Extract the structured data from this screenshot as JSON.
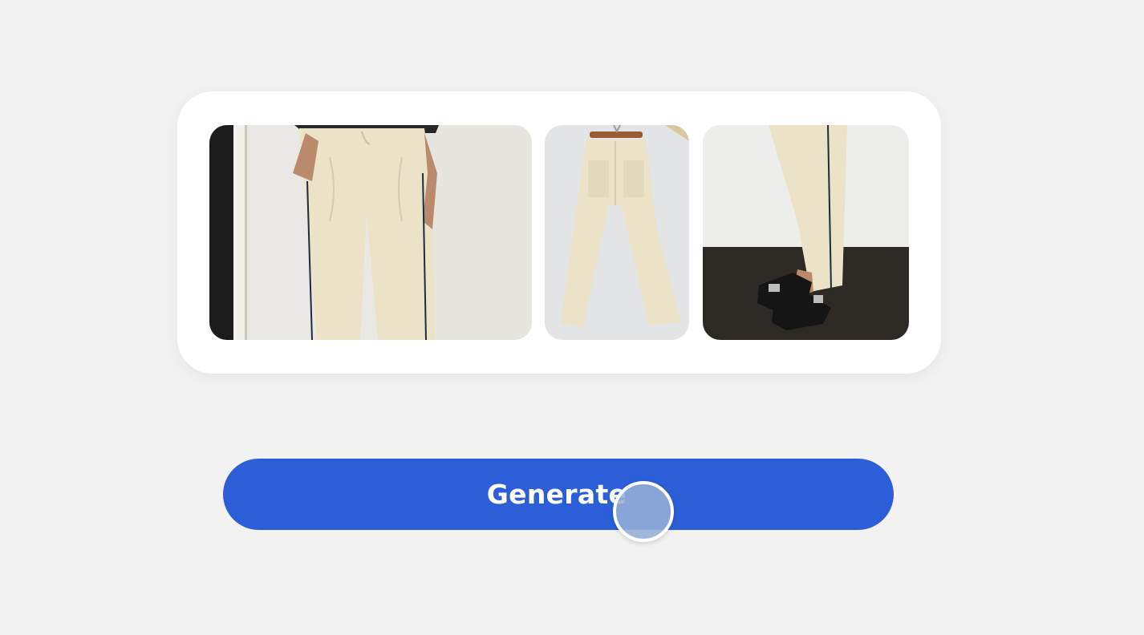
{
  "gallery": {
    "photos": [
      {
        "subject": "model-front-trousers"
      },
      {
        "subject": "trousers-on-hanger-back"
      },
      {
        "subject": "trousers-side-with-sandals"
      }
    ]
  },
  "generate_button": {
    "label": "Generate"
  },
  "colors": {
    "background": "#f2f2f2",
    "card": "#ffffff",
    "accent": "#2c5fd7",
    "trousers": "#ebe2c8"
  }
}
